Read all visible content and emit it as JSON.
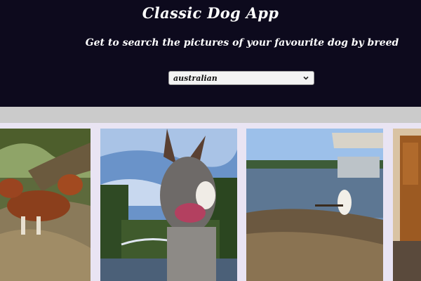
{
  "app": {
    "title": "Classic Dog App",
    "subtitle": "Get to search the pictures of your favourite dog by breed"
  },
  "breed_select": {
    "selected": "australian",
    "icon": "chevron-down-icon"
  },
  "gallery": {
    "images": [
      {
        "subject": "dog-photo-tree"
      },
      {
        "subject": "dog-photo-portrait"
      },
      {
        "subject": "dog-photo-lake"
      },
      {
        "subject": "dog-photo-room"
      }
    ]
  },
  "colors": {
    "header_bg": "#0d0a1d",
    "band": "#cbcbcb",
    "page_bg": "#e9e4f3"
  }
}
